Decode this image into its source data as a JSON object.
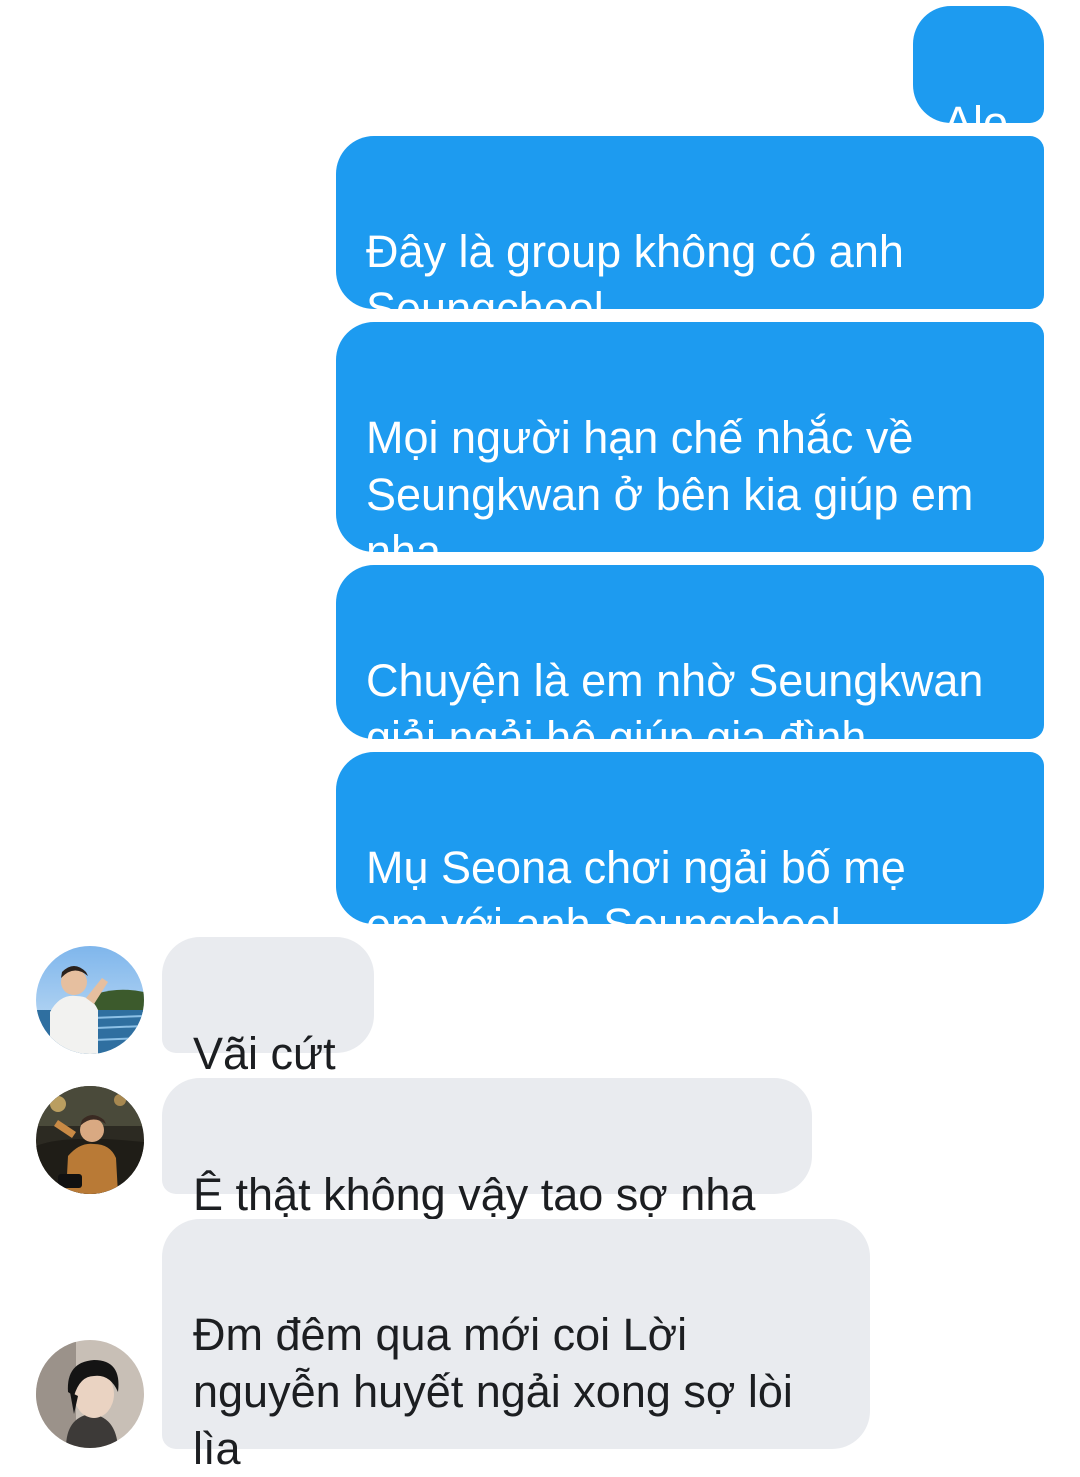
{
  "conversation": {
    "outgoing": [
      {
        "text": "Alo"
      },
      {
        "text": "Đây là group không có anh\nSeungcheol"
      },
      {
        "text": "Mọi người hạn chế nhắc về\nSeungkwan ở bên kia giúp em\nnha"
      },
      {
        "text": "Chuyện là em nhờ Seungkwan\ngiải ngải hộ giúp gia đình"
      },
      {
        "text": "Mụ Seona chơi ngải bố mẹ\nem với anh Seungcheol"
      }
    ],
    "incoming": [
      {
        "text": "Vãi cứt",
        "avatar": "profile-photo-seaside"
      },
      {
        "text": "Ê thật không vậy tao sợ nha",
        "avatar": "profile-photo-night-street"
      },
      {
        "text": "Đm đêm qua mới coi Lời\nnguyễn huyết ngải xong sợ lòi\nlìa",
        "avatar": "profile-photo-portrait"
      }
    ]
  },
  "colors": {
    "outgoing_bubble": "#1d9bf0",
    "incoming_bubble": "#e9ebef",
    "background": "#ffffff"
  }
}
